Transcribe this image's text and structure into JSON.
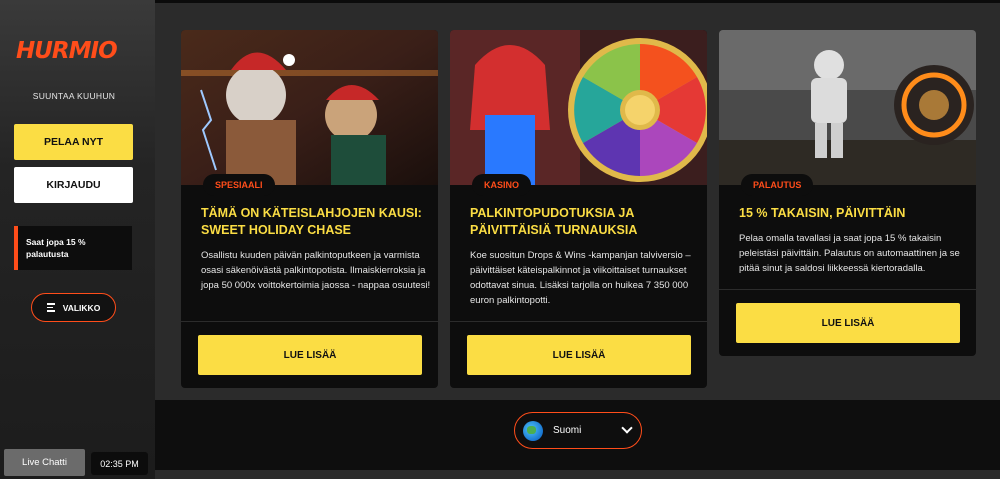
{
  "sidebar": {
    "logo": "HURMIO",
    "tagline": "SUUNTAA KUUHUN",
    "play_label": "PELAA NYT",
    "login_label": "KIRJAUDU",
    "promo_text": "Saat jopa 15 % palautusta",
    "menu_label": "VALIKKO",
    "live_chat_label": "Live Chatti",
    "clock": "02:35 PM"
  },
  "cards": [
    {
      "badge": "SPESIAALI",
      "title": "TÄMÄ ON KÄTEISLAHJOJEN KAUSI: SWEET HOLIDAY CHASE",
      "description": "Osallistu kuuden päivän palkintoputkeen ja varmista osasi säkenöivästä palkintopotista. Ilmaiskierroksia ja jopa 50 000x voittokertoimia jaossa - nappaa osuutesi!",
      "button": "LUE LISÄÄ"
    },
    {
      "badge": "KASINO",
      "title": "PALKINTOPUDOTUKSIA JA PÄIVITTÄISIÄ TURNAUKSIA",
      "description": "Koe suositun Drops & Wins -kampanjan talviversio – päivittäiset käteispalkinnot ja viikoittaiset turnaukset odottavat sinua. Lisäksi tarjolla on huikea 7 350 000 euron palkintopotti.",
      "button": "LUE LISÄÄ"
    },
    {
      "badge": "PALAUTUS",
      "title": "15 % TAKAISIN, PÄIVITTÄIN",
      "description": "Pelaa omalla tavallasi ja saat jopa 15 % takaisin peleistäsi päivittäin. Palautus on automaattinen ja se pitää sinut ja saldosi liikkeessä kiertoradalla.",
      "button": "LUE LISÄÄ"
    }
  ],
  "footer": {
    "language": "Suomi"
  },
  "colors": {
    "accent": "#ff4d1a",
    "button": "#fbdd44",
    "card_bg": "#0d0d0d"
  }
}
